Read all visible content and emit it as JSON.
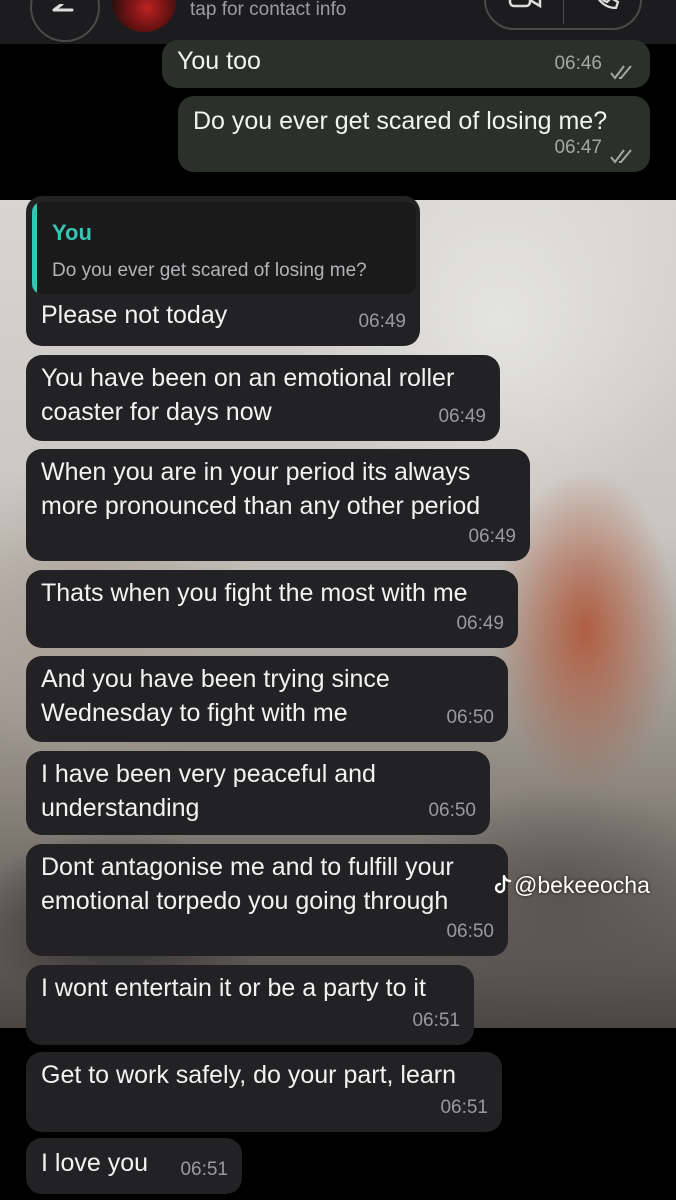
{
  "header": {
    "subtitle": "tap for contact info",
    "back_icon": "chevron-left-icon",
    "video_icon": "video-camera-icon",
    "call_icon": "phone-icon"
  },
  "colors": {
    "outgoing_bubble": "#2b312a",
    "incoming_bubble": "#222224",
    "reply_accent": "#37c4b4",
    "timestamp": "#9a9a9e"
  },
  "messages": [
    {
      "direction": "out",
      "lines": [
        "You too"
      ],
      "time": "06:46",
      "status": "read"
    },
    {
      "direction": "out",
      "lines": [
        "Do you ever get scared of losing me?"
      ],
      "time": "06:47",
      "status": "read"
    },
    {
      "direction": "in",
      "reply_to": {
        "author": "You",
        "text": "Do you ever get scared of losing me?"
      },
      "lines": [
        "Please not today"
      ],
      "time": "06:49"
    },
    {
      "direction": "in",
      "lines": [
        "You have been on an emotional roller",
        "coaster for days now"
      ],
      "time": "06:49"
    },
    {
      "direction": "in",
      "lines": [
        "When you are in your period its always",
        "more pronounced than any other period"
      ],
      "time": "06:49"
    },
    {
      "direction": "in",
      "lines": [
        "Thats when you fight the most with me"
      ],
      "time": "06:49"
    },
    {
      "direction": "in",
      "lines": [
        "And you have been trying since",
        "Wednesday to fight with me"
      ],
      "time": "06:50"
    },
    {
      "direction": "in",
      "lines": [
        "I have been very peaceful and",
        "understanding"
      ],
      "time": "06:50"
    },
    {
      "direction": "in",
      "lines": [
        "Dont antagonise me and to fulfill your",
        "emotional torpedo you going through"
      ],
      "time": "06:50"
    },
    {
      "direction": "in",
      "lines": [
        "I wont entertain it or be a party to it"
      ],
      "time": "06:51"
    },
    {
      "direction": "in",
      "lines": [
        "Get to work safely, do your part, learn"
      ],
      "time": "06:51"
    },
    {
      "direction": "in",
      "lines": [
        "I love you"
      ],
      "time": "06:51"
    }
  ],
  "watermark": {
    "handle": "@bekeeocha",
    "icon": "tiktok-icon"
  }
}
